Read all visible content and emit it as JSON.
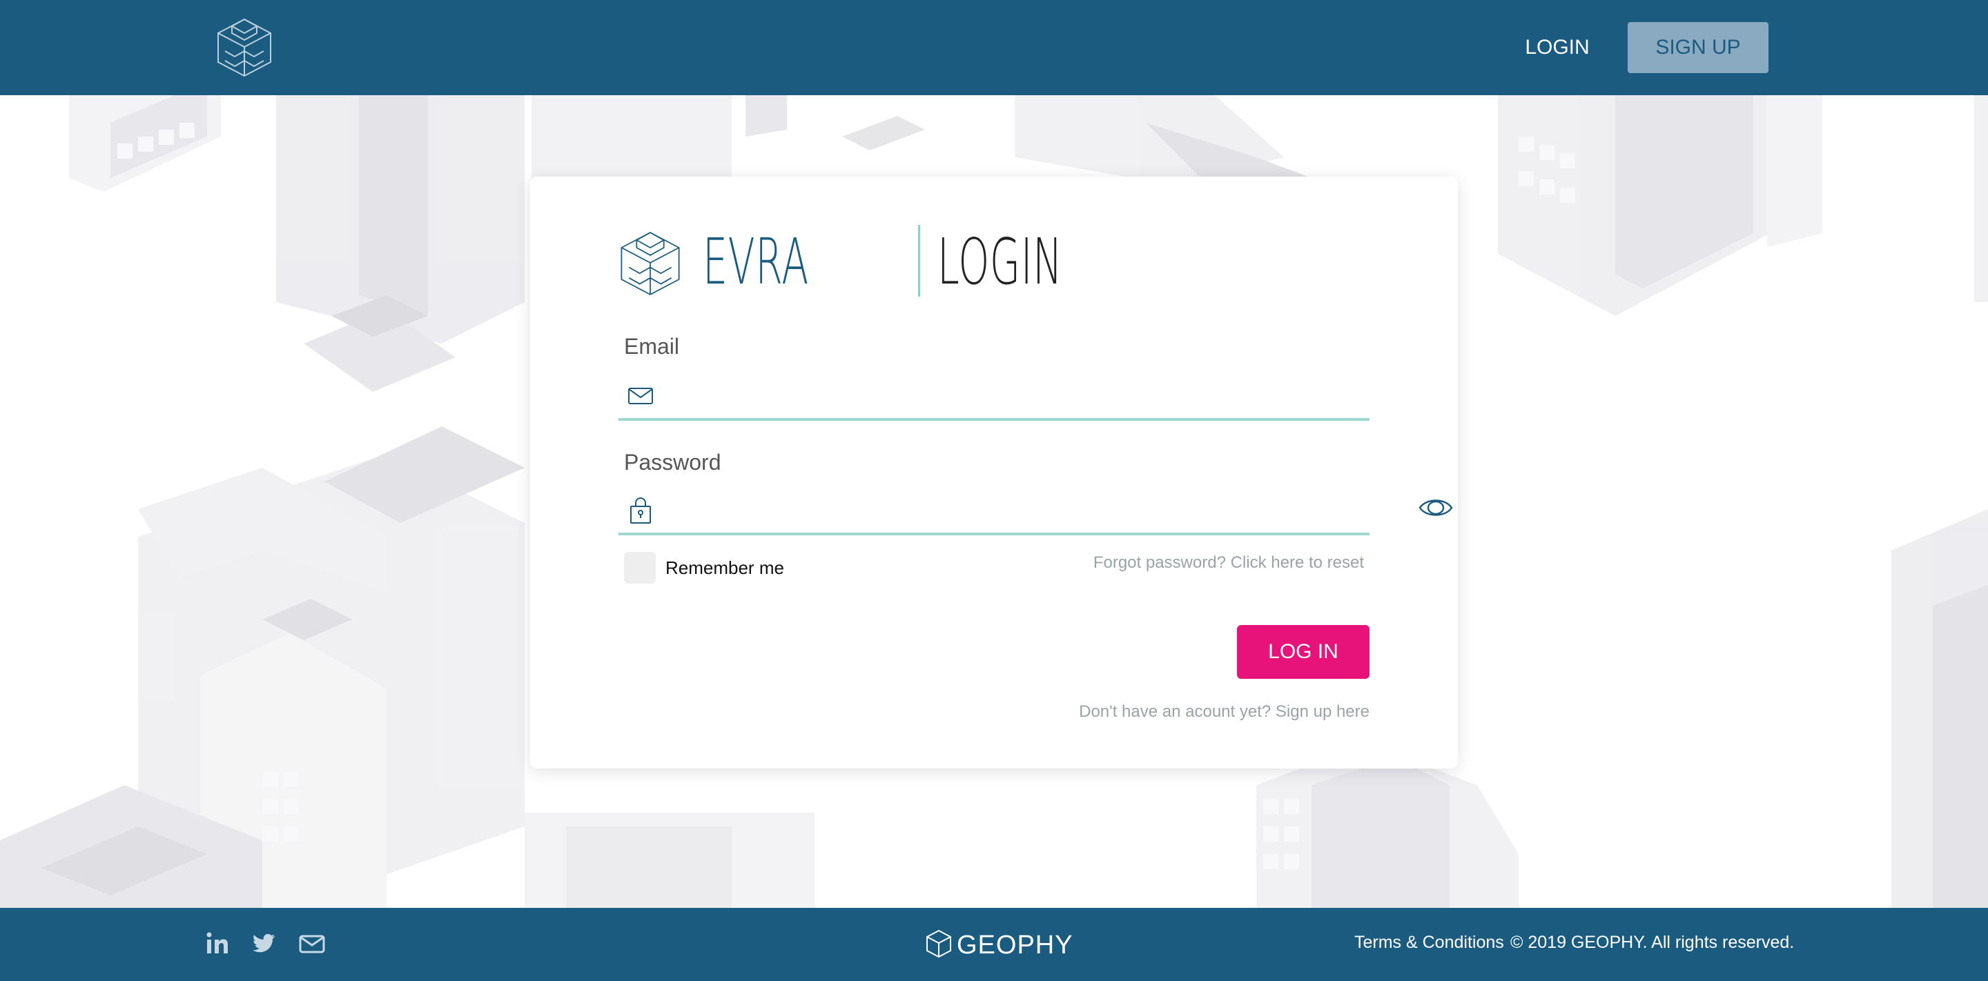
{
  "header": {
    "login_label": "LOGIN",
    "signup_label": "SIGN UP"
  },
  "card": {
    "brand_name": "EVRA",
    "brand_title": "LOGIN",
    "email_label": "Email",
    "email_value": "",
    "password_label": "Password",
    "password_value": "",
    "remember_label": "Remember me",
    "forgot_link": "Forgot password? Click here to reset",
    "login_button": "LOG IN",
    "signup_link": "Don't have an acount yet? Sign up here"
  },
  "footer": {
    "social_icons": [
      "linkedin-icon",
      "twitter-icon",
      "mail-icon"
    ],
    "company": "GEOPHY",
    "terms_link": "Terms & Conditions",
    "copyright": "© 2019 GEOPHY.  All rights reserved."
  },
  "colors": {
    "header_bg": "#1c5b80",
    "signup_button_bg": "#8aaac1",
    "primary_button": "#e8127b",
    "field_underline": "#9fd6cf"
  }
}
